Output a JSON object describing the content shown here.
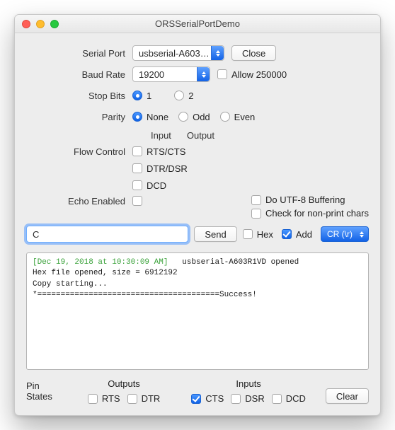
{
  "window": {
    "title": "ORSSerialPortDemo"
  },
  "serial_port": {
    "label": "Serial Port",
    "value": "usbserial-A603…",
    "close": "Close"
  },
  "baud_rate": {
    "label": "Baud Rate",
    "value": "19200",
    "allow_250000": "Allow 250000"
  },
  "stop_bits": {
    "label": "Stop Bits",
    "opt1": "1",
    "opt2": "2",
    "selected": "1"
  },
  "parity": {
    "label": "Parity",
    "none": "None",
    "odd": "Odd",
    "even": "Even",
    "selected": "None"
  },
  "io_headers": {
    "input": "Input",
    "output": "Output"
  },
  "flow_control": {
    "label": "Flow Control",
    "rtscts": "RTS/CTS",
    "dtrdsr": "DTR/DSR",
    "dcd": "DCD"
  },
  "echo": {
    "label": "Echo Enabled"
  },
  "options": {
    "utf8": "Do UTF-8 Buffering",
    "nonprint": "Check for non-print chars"
  },
  "send": {
    "value": "C",
    "button": "Send",
    "hex": "Hex",
    "add": "Add",
    "terminator": "CR (\\r)"
  },
  "log": {
    "ts": "[Dec 19, 2018 at 10:30:09 AM]",
    "line1_rest": "   usbserial-A603R1VD opened",
    "line2": "Hex file opened, size = 6912192",
    "line3": "Copy starting...",
    "line4": "*=======================================Success!"
  },
  "pins": {
    "label": "Pin States",
    "outputs": "Outputs",
    "inputs": "Inputs",
    "rts": "RTS",
    "dtr": "DTR",
    "cts": "CTS",
    "dsr": "DSR",
    "dcd": "DCD",
    "clear": "Clear"
  }
}
